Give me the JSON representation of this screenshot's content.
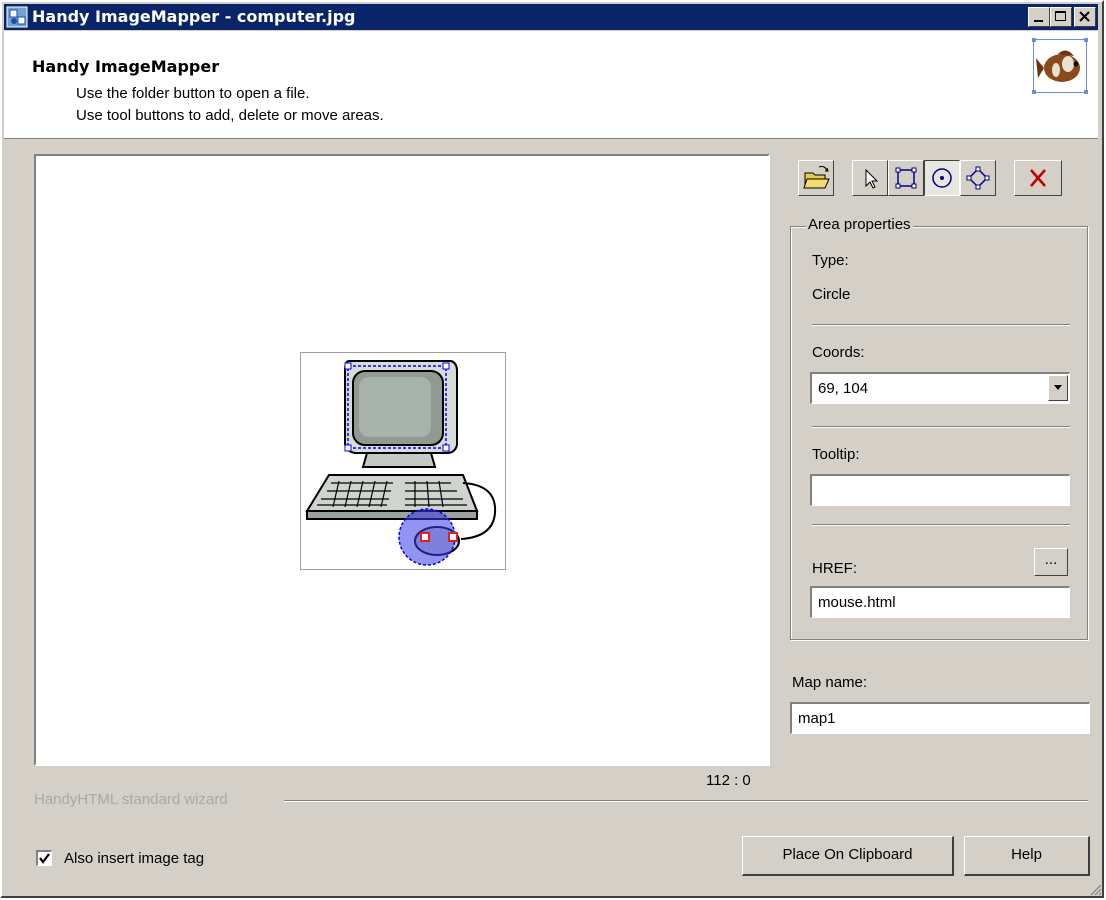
{
  "window": {
    "title": "Handy ImageMapper - computer.jpg"
  },
  "header": {
    "title": "Handy ImageMapper",
    "line1": "Use the folder button to open a file.",
    "line2": "Use tool buttons to add, delete or move areas."
  },
  "toolbar": {
    "tools": [
      {
        "icon": "open-folder-icon"
      },
      {
        "icon": "pointer-icon"
      },
      {
        "icon": "rectangle-tool-icon"
      },
      {
        "icon": "circle-tool-icon",
        "pressed": true
      },
      {
        "icon": "polygon-tool-icon"
      },
      {
        "icon": "delete-icon"
      }
    ]
  },
  "area": {
    "legend": "Area properties",
    "type_label": "Type:",
    "type_value": "Circle",
    "coords_label": "Coords:",
    "coords_value": "69, 104",
    "tooltip_label": "Tooltip:",
    "tooltip_value": "",
    "href_label": "HREF:",
    "href_browse": "...",
    "href_value": "mouse.html"
  },
  "map": {
    "name_label": "Map name:",
    "name_value": "map1"
  },
  "status": {
    "coords": "112 : 0"
  },
  "footer": {
    "wizard_label": "HandyHTML standard wizard",
    "checkbox_label": "Also insert image tag",
    "checkbox_checked": true,
    "clipboard_button": "Place On Clipboard",
    "help_button": "Help"
  },
  "colors": {
    "titlebar": "#0a246a",
    "face": "#d4d0c8",
    "selection": "#0000ff",
    "delete": "#c00000"
  }
}
